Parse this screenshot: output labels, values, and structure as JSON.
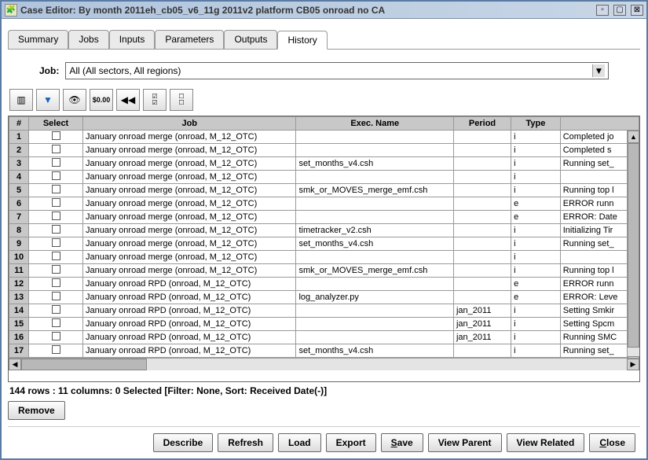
{
  "window": {
    "title": "Case Editor: By month 2011eh_cb05_v6_11g 2011v2 platform CB05 onroad no CA"
  },
  "tabs": [
    {
      "label": "Summary"
    },
    {
      "label": "Jobs"
    },
    {
      "label": "Inputs"
    },
    {
      "label": "Parameters"
    },
    {
      "label": "Outputs"
    },
    {
      "label": "History"
    }
  ],
  "activeTab": 5,
  "jobFilter": {
    "label": "Job:",
    "value": "All (All sectors, All regions)"
  },
  "columns": [
    "#",
    "Select",
    "Job",
    "Exec. Name",
    "Period",
    "Type",
    ""
  ],
  "rows": [
    {
      "n": "1",
      "job": "January onroad merge (onroad, M_12_OTC)",
      "exec": "",
      "period": "",
      "type": "i",
      "msg": "Completed jo"
    },
    {
      "n": "2",
      "job": "January onroad merge (onroad, M_12_OTC)",
      "exec": "",
      "period": "",
      "type": "i",
      "msg": "Completed s"
    },
    {
      "n": "3",
      "job": "January onroad merge (onroad, M_12_OTC)",
      "exec": "set_months_v4.csh",
      "period": "",
      "type": "i",
      "msg": "Running set_"
    },
    {
      "n": "4",
      "job": "January onroad merge (onroad, M_12_OTC)",
      "exec": "",
      "period": "",
      "type": "i",
      "msg": ""
    },
    {
      "n": "5",
      "job": "January onroad merge (onroad, M_12_OTC)",
      "exec": "smk_or_MOVES_merge_emf.csh",
      "period": "",
      "type": "i",
      "msg": "Running top l"
    },
    {
      "n": "6",
      "job": "January onroad merge (onroad, M_12_OTC)",
      "exec": "",
      "period": "",
      "type": "e",
      "msg": "ERROR runn"
    },
    {
      "n": "7",
      "job": "January onroad merge (onroad, M_12_OTC)",
      "exec": "",
      "period": "",
      "type": "e",
      "msg": "ERROR: Date"
    },
    {
      "n": "8",
      "job": "January onroad merge (onroad, M_12_OTC)",
      "exec": "timetracker_v2.csh",
      "period": "",
      "type": "i",
      "msg": "Initializing Tir"
    },
    {
      "n": "9",
      "job": "January onroad merge (onroad, M_12_OTC)",
      "exec": "set_months_v4.csh",
      "period": "",
      "type": "i",
      "msg": "Running set_"
    },
    {
      "n": "10",
      "job": "January onroad merge (onroad, M_12_OTC)",
      "exec": "",
      "period": "",
      "type": "i",
      "msg": ""
    },
    {
      "n": "11",
      "job": "January onroad merge (onroad, M_12_OTC)",
      "exec": "smk_or_MOVES_merge_emf.csh",
      "period": "",
      "type": "i",
      "msg": "Running top l"
    },
    {
      "n": "12",
      "job": "January onroad RPD (onroad, M_12_OTC)",
      "exec": "",
      "period": "",
      "type": "e",
      "msg": "ERROR runn"
    },
    {
      "n": "13",
      "job": "January onroad RPD (onroad, M_12_OTC)",
      "exec": "log_analyzer.py",
      "period": "",
      "type": "e",
      "msg": "ERROR: Leve"
    },
    {
      "n": "14",
      "job": "January onroad RPD (onroad, M_12_OTC)",
      "exec": "",
      "period": "jan_2011",
      "type": "i",
      "msg": "Setting Smkir"
    },
    {
      "n": "15",
      "job": "January onroad RPD (onroad, M_12_OTC)",
      "exec": "",
      "period": "jan_2011",
      "type": "i",
      "msg": "Setting Spcm"
    },
    {
      "n": "16",
      "job": "January onroad RPD (onroad, M_12_OTC)",
      "exec": "",
      "period": "jan_2011",
      "type": "i",
      "msg": "Running SMC"
    },
    {
      "n": "17",
      "job": "January onroad RPD (onroad, M_12_OTC)",
      "exec": "set_months_v4.csh",
      "period": "",
      "type": "i",
      "msg": "Running set_"
    }
  ],
  "status": "144 rows : 11 columns: 0 Selected [Filter: None, Sort: Received Date(-)]",
  "buttons": {
    "remove": "Remove",
    "describe": "Describe",
    "refresh": "Refresh",
    "load": "Load",
    "export": "Export",
    "save_pre": "",
    "save_u": "S",
    "save_post": "ave",
    "viewParent": "View Parent",
    "viewRelated": "View Related",
    "close_u": "C",
    "close_post": "lose"
  }
}
